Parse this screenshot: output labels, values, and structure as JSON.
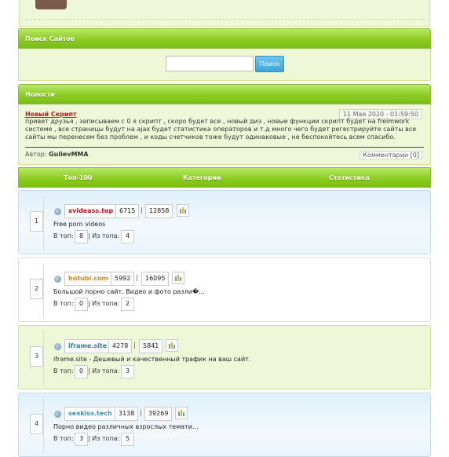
{
  "colors": {
    "header_green": "#8ccc22",
    "news_title": "#c4161c",
    "button_blue": "#3ca6db",
    "panel_green": "#eef7d8",
    "panel_blue": "#e9f4fb"
  },
  "search": {
    "title": "Поиск Сайтов",
    "placeholder": "",
    "button_label": "Поиск"
  },
  "news": {
    "header": "Новости",
    "title": "Новый Скрипт",
    "date": "11 Мая 2020 - 01:59:50",
    "text": "привет друзья , записываем с 0 я скрипт , скоро будет все , новый диз , новые функции скрипт будет на freimwork системе , все страницы будут на ajax будет статистика операторов и т.д много чего будет регестрируйте сайты все сайты мы перенесем без проблем , и коды счетчиков тоже будут одинаковые , не беспокойтесь всем спасибо.",
    "author_label": "Автор:",
    "author": "GulievMMA",
    "comments": "Комментарии [0]"
  },
  "table": {
    "col_top": "Топ-100",
    "col_categories": "Категории",
    "col_stats": "Статистика",
    "in_top_label": "В топ:",
    "from_top_label": "| Из топа:",
    "sep": "|",
    "rows": [
      {
        "rank": "1",
        "site": "xvideass.top",
        "site_color": "#c4161c",
        "hits": "6715",
        "hosts": "12858",
        "description": "Free porn videos",
        "in_top": "8",
        "from_top": "4"
      },
      {
        "rank": "2",
        "site": "hotubi.com",
        "site_color": "#e0861c",
        "hits": "5992",
        "hosts": "16095",
        "description": "Большой порно сайт. Видео и фото разли�...",
        "in_top": "0",
        "from_top": "2"
      },
      {
        "rank": "3",
        "site": "iframe.site",
        "site_color": "#2f7d9c",
        "hits": "4278",
        "hosts": "5841",
        "description": "iframe.site - Дешевый и качественный трафик на ваш сайт.",
        "in_top": "0",
        "from_top": "3"
      },
      {
        "rank": "4",
        "site": "sexkiss.tech",
        "site_color": "#3a8fb3",
        "hits": "3138",
        "hosts": "39269",
        "description": "Порно видео различных взрослых темати...",
        "in_top": "3",
        "from_top": "5"
      }
    ]
  }
}
